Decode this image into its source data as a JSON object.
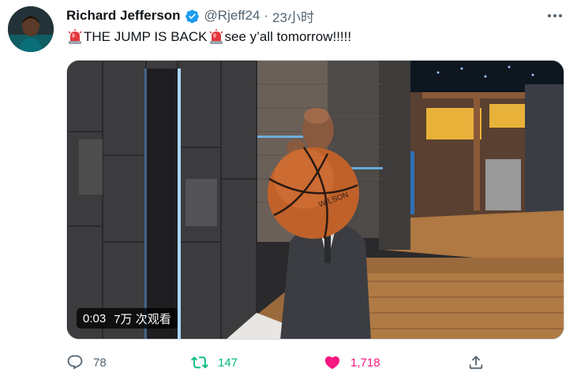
{
  "author": {
    "display_name": "Richard Jefferson",
    "handle": "@Rjeff24",
    "separator": "·",
    "time": "23小时"
  },
  "tweet": {
    "text_part1": "THE JUMP IS BACK",
    "text_part2": "see y’all tomorrow!!!!!"
  },
  "video": {
    "duration": "0:03",
    "views": "7万 次观看"
  },
  "actions": {
    "reply_count": "78",
    "retweet_count": "147",
    "like_count": "1,718"
  },
  "colors": {
    "verified": "#1d9bf0",
    "retweet": "#00ba7c",
    "like": "#f91880",
    "muted": "#536471"
  },
  "icons": {
    "verified": "verified-badge-icon",
    "more": "more-options-icon",
    "siren": "siren-emoji-icon",
    "reply": "reply-icon",
    "retweet": "retweet-icon",
    "like": "heart-icon",
    "share": "share-icon"
  }
}
